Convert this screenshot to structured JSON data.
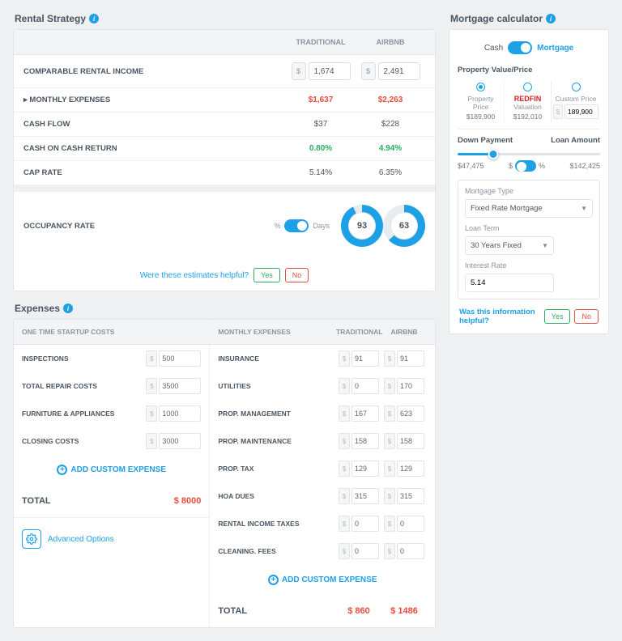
{
  "rental": {
    "title": "Rental Strategy",
    "colTrad": "TRADITIONAL",
    "colAirbnb": "AIRBNB",
    "rows": {
      "income": {
        "label": "COMPARABLE RENTAL INCOME",
        "trad": "1,674",
        "airbnb": "2,491"
      },
      "monthly": {
        "label": "▸ MONTHLY EXPENSES",
        "trad": "$1,637",
        "airbnb": "$2,263"
      },
      "cashflow": {
        "label": "CASH FLOW",
        "trad": "$37",
        "airbnb": "$228"
      },
      "coc": {
        "label": "CASH ON CASH RETURN",
        "trad": "0.80%",
        "airbnb": "4.94%"
      },
      "cap": {
        "label": "CAP RATE",
        "trad": "5.14%",
        "airbnb": "6.35%"
      }
    },
    "occ": {
      "label": "OCCUPANCY RATE",
      "pct": "%",
      "days": "Days",
      "trad": "93",
      "airbnb": "63"
    },
    "helpful": "Were these estimates helpful?",
    "yes": "Yes",
    "no": "No"
  },
  "expenses": {
    "title": "Expenses",
    "startupHdr": "ONE TIME STARTUP COSTS",
    "monthlyHdr": "MONTHLY EXPENSES",
    "colTrad": "TRADITIONAL",
    "colAirbnb": "AIRBNB",
    "startup": {
      "inspections": {
        "label": "INSPECTIONS",
        "val": "500"
      },
      "repair": {
        "label": "TOTAL REPAIR COSTS",
        "val": "3500"
      },
      "furniture": {
        "label": "FURNITURE & APPLIANCES",
        "val": "1000"
      },
      "closing": {
        "label": "CLOSING COSTS",
        "val": "3000"
      }
    },
    "monthly": {
      "insurance": {
        "label": "INSURANCE",
        "t": "91",
        "a": "91"
      },
      "utilities": {
        "label": "UTILITIES",
        "t": "0",
        "a": "170"
      },
      "mgmt": {
        "label": "PROP. MANAGEMENT",
        "t": "167",
        "a": "623"
      },
      "maint": {
        "label": "PROP. MAINTENANCE",
        "t": "158",
        "a": "158"
      },
      "tax": {
        "label": "PROP. TAX",
        "t": "129",
        "a": "129"
      },
      "hoa": {
        "label": "HOA DUES",
        "t": "315",
        "a": "315"
      },
      "rinc": {
        "label": "RENTAL INCOME TAXES",
        "t": "0",
        "a": "0"
      },
      "cleaning": {
        "label": "CLEANING. FEES",
        "t": "0",
        "a": "0"
      }
    },
    "addCustom": "ADD CUSTOM EXPENSE",
    "totalLabel": "TOTAL",
    "totalStartup": "$ 8000",
    "totalTrad": "$ 860",
    "totalAirbnb": "$ 1486",
    "advanced": "Advanced Options"
  },
  "mortgage": {
    "title": "Mortgage calculator",
    "cash": "Cash",
    "mortgage": "Mortgage",
    "pvLabel": "Property Value/Price",
    "pv": {
      "pp": {
        "label": "Property Price",
        "val": "$189,900"
      },
      "rv": {
        "label": "Valuation",
        "brand": "REDFIN",
        "val": "$192,010"
      },
      "cp": {
        "label": "Custom Price",
        "val": "189,900"
      }
    },
    "dp": {
      "left": "Down Payment",
      "right": "Loan Amount",
      "dpVal": "$47,475",
      "loanVal": "$142,425",
      "unitDollar": "$",
      "unitPct": "%"
    },
    "mtLabel": "Mortgage Type",
    "mtVal": "Fixed Rate Mortgage",
    "ltLabel": "Loan Term",
    "ltVal": "30 Years Fixed",
    "irLabel": "Interest Rate",
    "irVal": "5.14",
    "helpful": "Was this information helpful?",
    "yes": "Yes",
    "no": "No"
  }
}
